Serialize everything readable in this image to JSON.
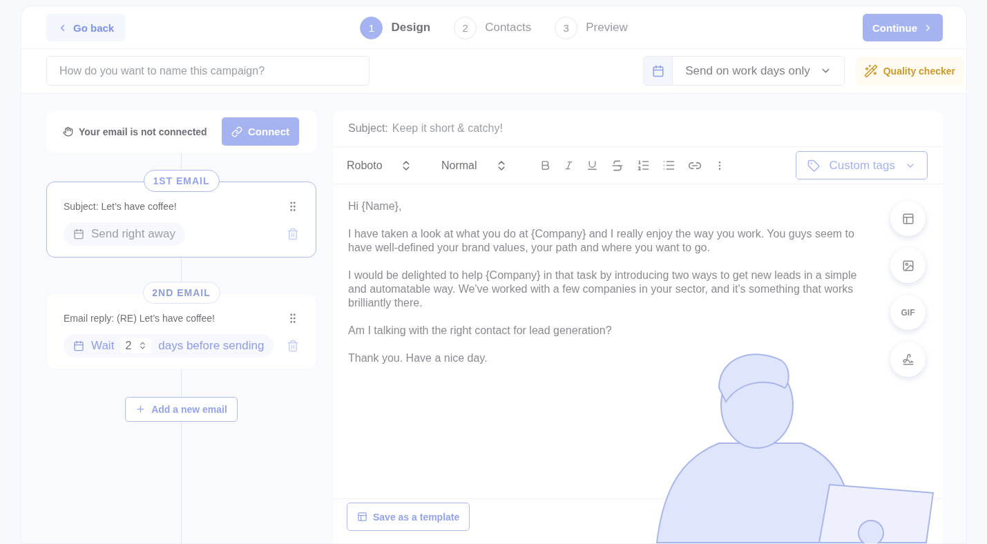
{
  "header": {
    "back": "Go back",
    "steps": [
      {
        "number": "1",
        "label": "Design",
        "selected": true
      },
      {
        "number": "2",
        "label": "Contacts",
        "selected": false
      },
      {
        "number": "3",
        "label": "Preview",
        "selected": false
      }
    ],
    "continue": "Continue"
  },
  "campaign": {
    "placeholder": "How do you want to name this campaign?",
    "schedule": "Send on work days only",
    "quality_checker": "Quality checker"
  },
  "connection": {
    "message": "Your email is not connected",
    "button": "Connect"
  },
  "emails": [
    {
      "badge": "1ST EMAIL",
      "selected": true,
      "subject": "Subject: Let’s have coffee!",
      "kind": "immediate",
      "schedule": "Send right away"
    },
    {
      "badge": "2ND EMAIL",
      "selected": false,
      "subject": "Email reply: (RE) Let’s have coffee!",
      "kind": "wait",
      "wait_label": "Wait",
      "days": "2",
      "after": "days before sending"
    }
  ],
  "add_email": "Add a new email",
  "editor": {
    "subject_label": "Subject:",
    "subject_placeholder": "Keep it short & catchy!",
    "font": "Roboto",
    "size": "Normal",
    "custom_tags": "Custom tags",
    "body": [
      "Hi {Name},",
      "I have taken a look at what you do at {Company} and I really enjoy the way you work. You guys seem to have well-defined your brand values, your path and where you want to go.",
      "I would be delighted to help {Company} in that task by introducing two ways to get new leads in a simple and automatable way. We've worked with a few companies in your sector, and it's something that works brilliantly there.",
      "Am I talking with the right contact for lead generation?",
      "Thank you. Have a nice day."
    ],
    "side_tools": [
      {
        "kind": "layout"
      },
      {
        "kind": "image"
      },
      {
        "kind": "text",
        "label": "GIF"
      },
      {
        "kind": "signature"
      }
    ],
    "save_template": "Save as a template"
  }
}
